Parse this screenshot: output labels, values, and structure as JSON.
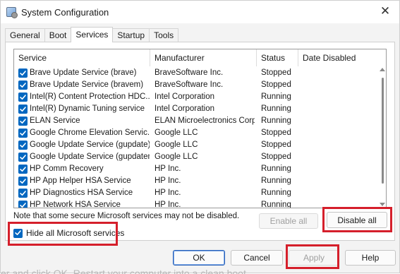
{
  "window": {
    "title": "System Configuration",
    "close_glyph": "✕"
  },
  "tabs": [
    {
      "label": "General",
      "active": false
    },
    {
      "label": "Boot",
      "active": false
    },
    {
      "label": "Services",
      "active": true
    },
    {
      "label": "Startup",
      "active": false
    },
    {
      "label": "Tools",
      "active": false
    }
  ],
  "services": {
    "columns": [
      "Service",
      "Manufacturer",
      "Status",
      "Date Disabled"
    ],
    "rows": [
      {
        "checked": true,
        "service": "Brave Update Service (brave)",
        "manufacturer": "BraveSoftware Inc.",
        "status": "Stopped",
        "date_disabled": ""
      },
      {
        "checked": true,
        "service": "Brave Update Service (bravem)",
        "manufacturer": "BraveSoftware Inc.",
        "status": "Stopped",
        "date_disabled": ""
      },
      {
        "checked": true,
        "service": "Intel(R) Content Protection HDC...",
        "manufacturer": "Intel Corporation",
        "status": "Running",
        "date_disabled": ""
      },
      {
        "checked": true,
        "service": "Intel(R) Dynamic Tuning service",
        "manufacturer": "Intel Corporation",
        "status": "Running",
        "date_disabled": ""
      },
      {
        "checked": true,
        "service": "ELAN Service",
        "manufacturer": "ELAN Microelectronics Corp.",
        "status": "Running",
        "date_disabled": ""
      },
      {
        "checked": true,
        "service": "Google Chrome Elevation Servic...",
        "manufacturer": "Google LLC",
        "status": "Stopped",
        "date_disabled": ""
      },
      {
        "checked": true,
        "service": "Google Update Service (gupdate)",
        "manufacturer": "Google LLC",
        "status": "Stopped",
        "date_disabled": ""
      },
      {
        "checked": true,
        "service": "Google Update Service (gupdatem)",
        "manufacturer": "Google LLC",
        "status": "Stopped",
        "date_disabled": ""
      },
      {
        "checked": true,
        "service": "HP Comm Recovery",
        "manufacturer": "HP Inc.",
        "status": "Running",
        "date_disabled": ""
      },
      {
        "checked": true,
        "service": "HP App Helper HSA Service",
        "manufacturer": "HP Inc.",
        "status": "Running",
        "date_disabled": ""
      },
      {
        "checked": true,
        "service": "HP Diagnostics HSA Service",
        "manufacturer": "HP Inc.",
        "status": "Running",
        "date_disabled": ""
      },
      {
        "checked": true,
        "service": "HP Network HSA Service",
        "manufacturer": "HP Inc.",
        "status": "Running",
        "date_disabled": ""
      }
    ],
    "note": "Note that some secure Microsoft services may not be disabled.",
    "enable_all_label": "Enable all",
    "disable_all_label": "Disable all",
    "hide_ms_label": "Hide all Microsoft services",
    "hide_ms_checked": true
  },
  "footer": {
    "ok_label": "OK",
    "cancel_label": "Cancel",
    "apply_label": "Apply",
    "help_label": "Help"
  },
  "background_caption": "er and click OK. Restart your computer into a clean boot",
  "colors": {
    "checkbox_blue": "#0067c0",
    "highlight_red": "#d51f2b"
  },
  "icons": {
    "app": "system-configuration-icon",
    "close": "close-icon",
    "check": "checkmark-icon"
  }
}
